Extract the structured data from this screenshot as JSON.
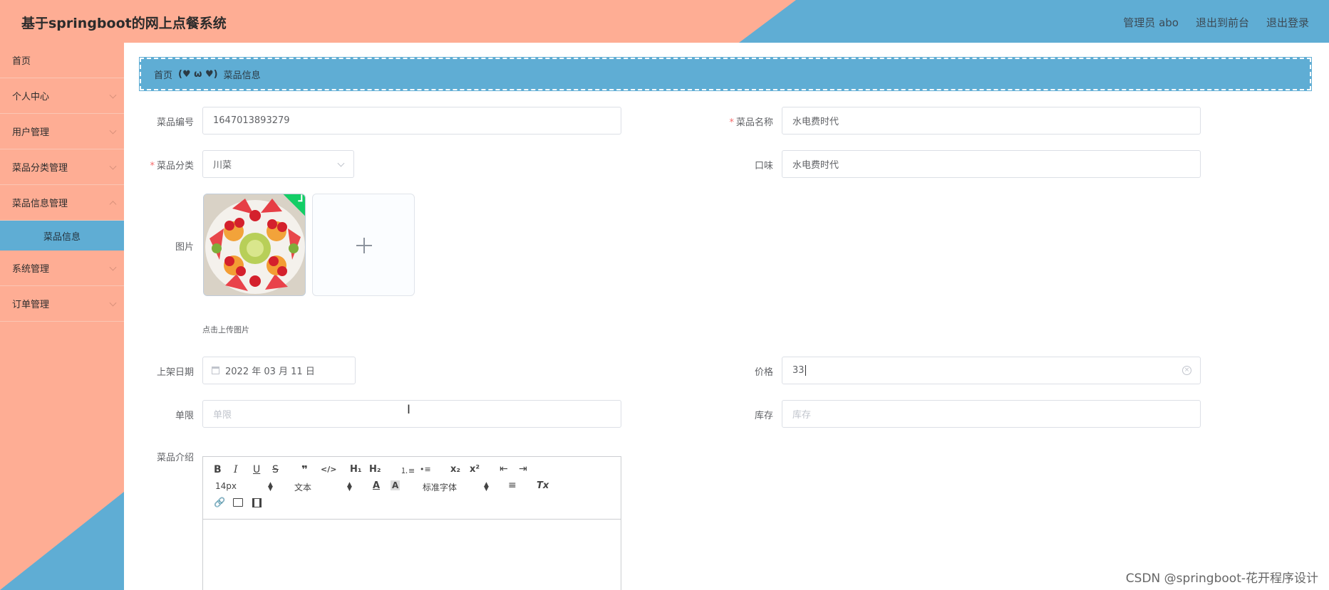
{
  "app": {
    "title": "基于springboot的网上点餐系统"
  },
  "header": {
    "user": "管理员 abo",
    "front": "退出到前台",
    "logout": "退出登录"
  },
  "sidebar": {
    "items": [
      {
        "label": "首页",
        "expandable": false
      },
      {
        "label": "个人中心",
        "expandable": true
      },
      {
        "label": "用户管理",
        "expandable": true
      },
      {
        "label": "菜品分类管理",
        "expandable": true
      },
      {
        "label": "菜品信息管理",
        "expandable": true
      },
      {
        "label": "菜品信息",
        "active": true
      },
      {
        "label": "系统管理",
        "expandable": true
      },
      {
        "label": "订单管理",
        "expandable": true
      }
    ]
  },
  "breadcrumb": {
    "home": "首页",
    "separator": "(♥ ω ♥)",
    "current": "菜品信息"
  },
  "form": {
    "code": {
      "label": "菜品编号",
      "value": "1647013893279"
    },
    "name": {
      "label": "菜品名称",
      "value": "水电费时代"
    },
    "category": {
      "label": "菜品分类",
      "value": "川菜"
    },
    "taste": {
      "label": "口味",
      "value": "水电费时代"
    },
    "image": {
      "label": "图片",
      "tip": "点击上传图片"
    },
    "date": {
      "label": "上架日期",
      "value": "2022 年 03 月 11 日"
    },
    "price": {
      "label": "价格",
      "value": "33"
    },
    "limit": {
      "label": "单限",
      "placeholder": "单限"
    },
    "stock": {
      "label": "库存",
      "placeholder": "库存"
    },
    "intro": {
      "label": "菜品介绍"
    }
  },
  "editor": {
    "bold": "B",
    "italic": "I",
    "underline": "U",
    "strike": "S",
    "quote": "❞",
    "code": "</>",
    "h1": "H₁",
    "h2": "H₂",
    "ol": "⒈≡",
    "ul": "•≡",
    "sub": "x₂",
    "sup": "x²",
    "outdent": "⇤",
    "indent": "⇥",
    "size": "14px",
    "header": "文本",
    "color": "A",
    "background": "A",
    "font": "标准字体",
    "align": "≡",
    "clean": "Tx"
  },
  "watermark": "CSDN @springboot-花开程序设计",
  "colors": {
    "salmon": "#fead94",
    "blue": "#5fadd4",
    "success": "#13ce66",
    "required": "#f56c6c"
  }
}
